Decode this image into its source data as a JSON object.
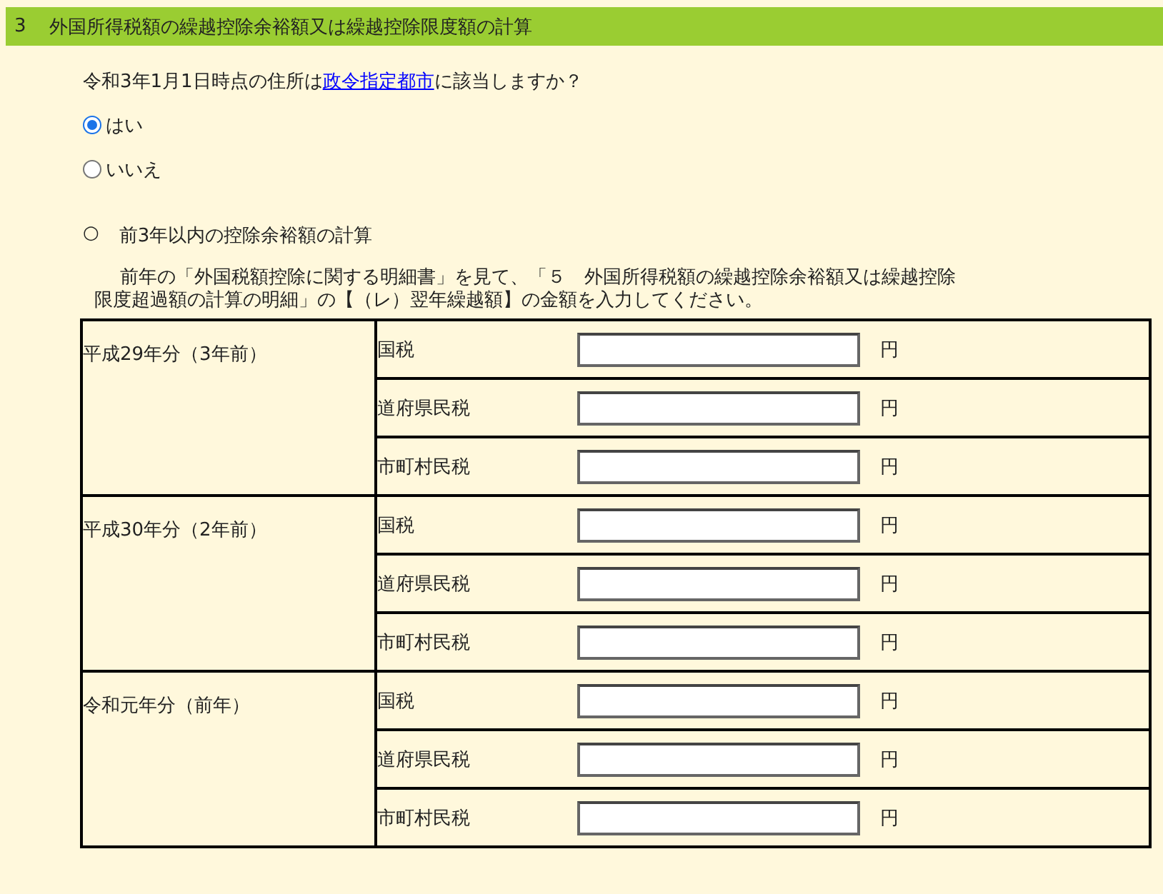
{
  "section": {
    "number": "3",
    "title": "外国所得税額の繰越控除余裕額又は繰越控除限度額の計算"
  },
  "question": {
    "before": "令和3年1月1日時点の住所は",
    "link": "政令指定都市",
    "after": "に該当しますか？"
  },
  "options": [
    {
      "label": "はい",
      "selected": true
    },
    {
      "label": "いいえ",
      "selected": false
    }
  ],
  "subsection": {
    "marker": "○",
    "title": "前3年以内の控除余裕額の計算"
  },
  "instructions": "前年の「外国税額控除に関する明細書」を見て、「５　外国所得税額の繰越控除余裕額又は繰越控除限度超過額の計算の明細」の【（レ）翌年繰越額】の金額を入力してください。",
  "table": {
    "groups": [
      {
        "period": "平成29年分（3年前）",
        "rows": [
          {
            "label": "国税",
            "unit": "円"
          },
          {
            "label": "道府県民税",
            "unit": "円"
          },
          {
            "label": "市町村民税",
            "unit": "円"
          }
        ]
      },
      {
        "period": "平成30年分（2年前）",
        "rows": [
          {
            "label": "国税",
            "unit": "円"
          },
          {
            "label": "道府県民税",
            "unit": "円"
          },
          {
            "label": "市町村民税",
            "unit": "円"
          }
        ]
      },
      {
        "period": "令和元年分（前年）",
        "rows": [
          {
            "label": "国税",
            "unit": "円"
          },
          {
            "label": "道府県民税",
            "unit": "円"
          },
          {
            "label": "市町村民税",
            "unit": "円"
          }
        ]
      }
    ]
  }
}
